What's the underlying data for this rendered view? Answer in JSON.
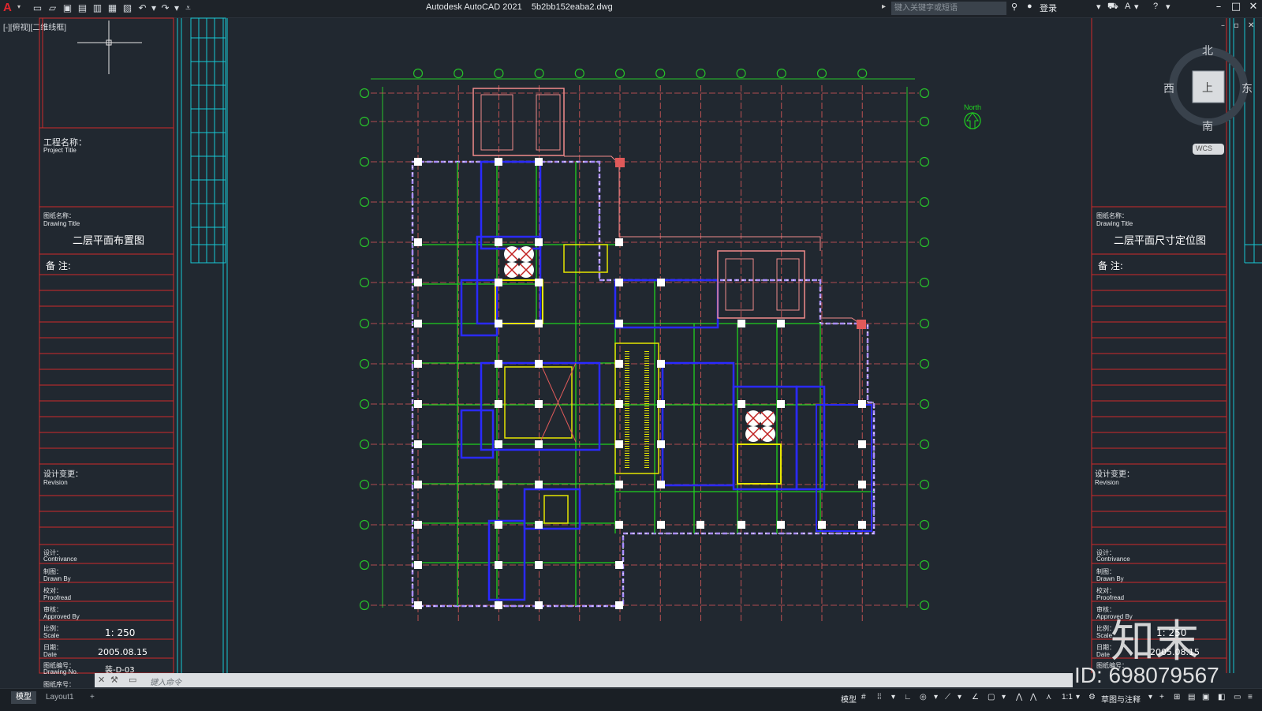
{
  "titlebar": {
    "app_title": "Autodesk AutoCAD 2021    5b2bb152eaba2.dwg",
    "search_placeholder": "键入关键字或短语",
    "login_label": "登录",
    "app_logo": "A"
  },
  "viewport": {
    "label": "[-][俯视][二维线框]"
  },
  "viewcube": {
    "north": "北",
    "south": "南",
    "east": "东",
    "west": "西",
    "top_face": "上",
    "wcs": "WCS"
  },
  "drawing": {
    "north_label": "North"
  },
  "title_block_left": {
    "project_title_cn": "工程名称：",
    "project_title_en": "Project Title",
    "drawing_title_cn": "图纸名称：",
    "drawing_title_en": "Drawing Title",
    "drawing_name": "二层平面布置图",
    "remarks": "备 注:",
    "revision_cn": "设计变更：",
    "revision_en": "Revision",
    "design_cn": "设计：",
    "design_en": "Contrivance",
    "drawn_cn": "制图：",
    "drawn_en": "Drawn By",
    "check_cn": "校对：",
    "check_en": "Proofread",
    "approve_cn": "审核：",
    "approve_en": "Approved By",
    "scale_cn": "比例：",
    "scale_en": "Scale",
    "scale_value": "1: 250",
    "date_cn": "日期：",
    "date_en": "Date",
    "date_value": "2005.08.15",
    "drawing_no_cn": "图纸编号：",
    "drawing_no_en": "Drawing No.",
    "drawing_no_value": "装-D-03",
    "sheet_cn": "图纸序号："
  },
  "title_block_right": {
    "drawing_title_cn": "图纸名称：",
    "drawing_title_en": "Drawing Title",
    "drawing_name": "二层平面尺寸定位图",
    "remarks": "备 注:",
    "revision_cn": "设计变更：",
    "revision_en": "Revision",
    "design_cn": "设计：",
    "design_en": "Contrivance",
    "drawn_cn": "制图：",
    "drawn_en": "Drawn By",
    "check_cn": "校对：",
    "check_en": "Proofread",
    "approve_cn": "审核：",
    "approve_en": "Approved By",
    "scale_cn": "比例：",
    "scale_en": "Scale",
    "scale_value": "1: 250",
    "date_cn": "日期：",
    "date_en": "Date",
    "date_value": "2005.08.15",
    "drawing_no_cn": "图纸编号："
  },
  "command": {
    "placeholder": "键入命令"
  },
  "tabs": [
    {
      "label": "模型",
      "active": true
    },
    {
      "label": "Layout1",
      "active": false
    }
  ],
  "statusbar": {
    "model_label": "模型",
    "scale_label": "1:1",
    "annotation_label": "草图与注释"
  },
  "watermark": {
    "id_text": "ID: 698079567",
    "logo_text": "知末"
  },
  "colors": {
    "background": "#212830",
    "grid": "#e05a5a",
    "axis_bubble": "#27c32a",
    "wall_blue": "#2a2aff",
    "wall_green": "#1fd21f",
    "yellow": "#e6e600",
    "white": "#ffffff",
    "frame_red": "#d02a2a",
    "frame_cyan": "#17c7d4"
  }
}
